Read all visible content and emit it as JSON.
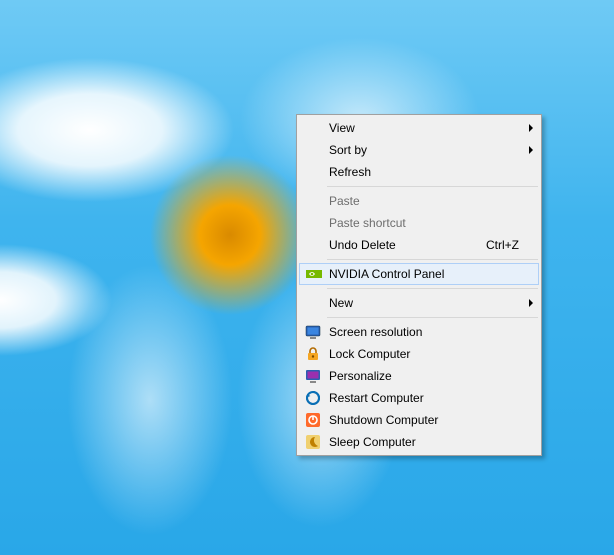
{
  "menu": {
    "items": [
      {
        "id": "view",
        "label": "View",
        "has_submenu": true
      },
      {
        "id": "sort-by",
        "label": "Sort by",
        "has_submenu": true
      },
      {
        "id": "refresh",
        "label": "Refresh"
      },
      {
        "separator": true
      },
      {
        "id": "paste",
        "label": "Paste",
        "disabled": true
      },
      {
        "id": "paste-shortcut",
        "label": "Paste shortcut",
        "disabled": true
      },
      {
        "id": "undo-delete",
        "label": "Undo Delete",
        "shortcut": "Ctrl+Z"
      },
      {
        "separator": true
      },
      {
        "id": "nvidia-control-panel",
        "label": "NVIDIA Control Panel",
        "icon": "nvidia-icon",
        "highlight": true
      },
      {
        "separator": true
      },
      {
        "id": "new",
        "label": "New",
        "has_submenu": true
      },
      {
        "separator": true
      },
      {
        "id": "screen-resolution",
        "label": "Screen resolution",
        "icon": "screen-resolution-icon"
      },
      {
        "id": "lock-computer",
        "label": "Lock Computer",
        "icon": "lock-icon"
      },
      {
        "id": "personalize",
        "label": "Personalize",
        "icon": "personalize-icon"
      },
      {
        "id": "restart-computer",
        "label": "Restart Computer",
        "icon": "restart-icon"
      },
      {
        "id": "shutdown-computer",
        "label": "Shutdown Computer",
        "icon": "shutdown-icon"
      },
      {
        "id": "sleep-computer",
        "label": "Sleep Computer",
        "icon": "sleep-icon"
      }
    ]
  }
}
